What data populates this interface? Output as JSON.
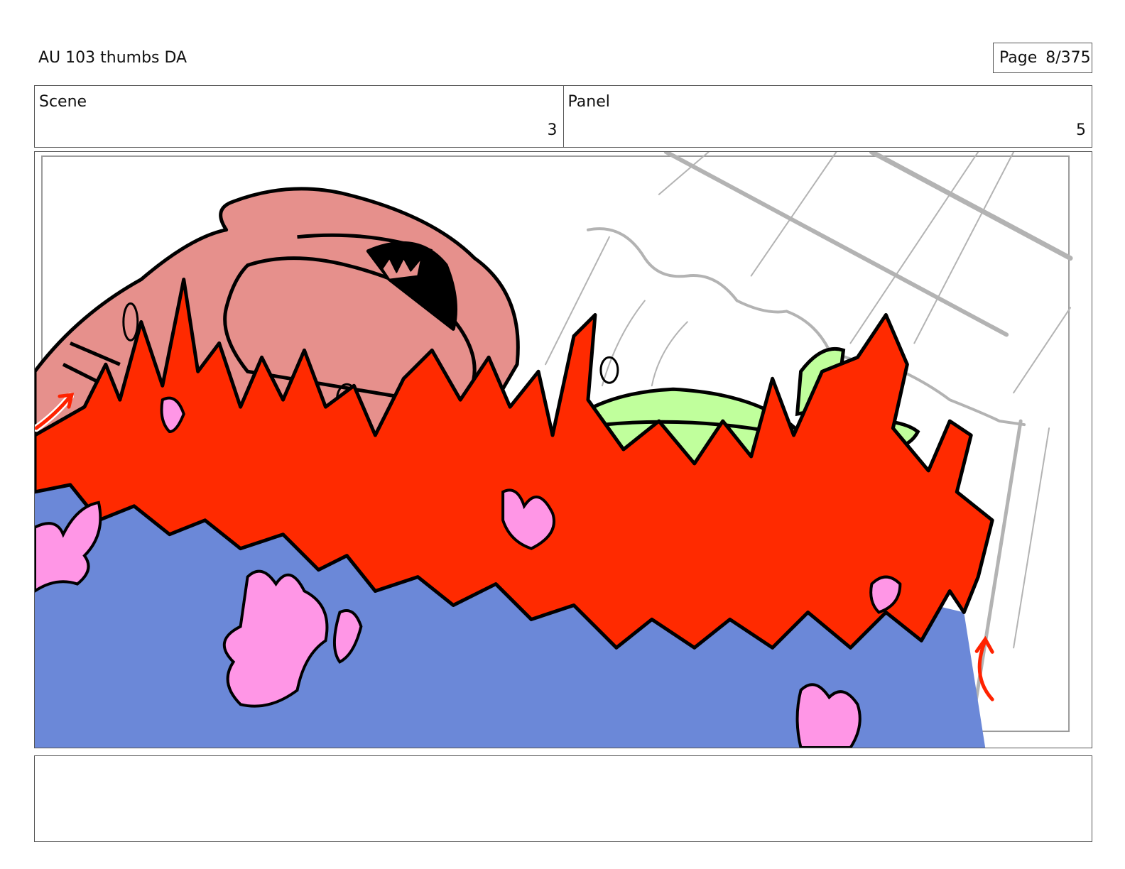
{
  "header": {
    "title": "AU 103 thumbs DA",
    "page_label": "Page",
    "page_value": "8/375"
  },
  "info": {
    "scene_label": "Scene",
    "scene_value": "3",
    "panel_label": "Panel",
    "panel_value": "5"
  },
  "colors": {
    "fire_red": "#ff2a00",
    "water_blue": "#6b88d8",
    "blossom_pink": "#ff96e6",
    "creature_salmon": "#e6908c",
    "creature_green": "#c0ff9c",
    "sketch_gray": "#b3b3b3",
    "arrow_red": "#ff2200"
  },
  "notes": {
    "text": ""
  }
}
